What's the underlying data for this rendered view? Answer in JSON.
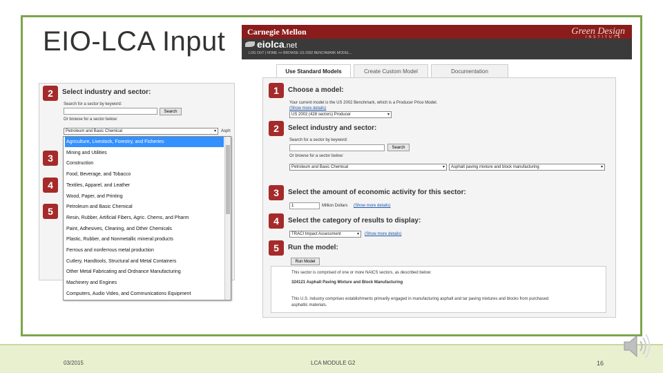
{
  "slide": {
    "title": "EIO-LCA Input",
    "footer_date": "03/2015",
    "footer_module": "LCA MODULE G2",
    "page_number": "16"
  },
  "site": {
    "cmu_logo": "Carnegie Mellon",
    "green_design": "Green Design",
    "green_design_sub": "INSTITUTE",
    "eiolca_name": "eiolca",
    "eiolca_tld": ".net",
    "nav_line": "LOG OUT | HOME >> BROWSE US 2002 BENCHMARK MODEL..."
  },
  "tabs": [
    {
      "label": "Use Standard Models",
      "active": true
    },
    {
      "label": "Create Custom Model",
      "active": false
    },
    {
      "label": "Documentation",
      "active": false
    }
  ],
  "right_panel": {
    "step1": {
      "num": "1",
      "heading": "Choose a model:",
      "current_text": "Your current model is the US 2002 Benchmark, which is a Producer Price Model.",
      "more_details": "(Show more details)",
      "model_select": "US 2002 (428 sectors) Producer"
    },
    "step2": {
      "num": "2",
      "heading": "Select industry and sector:",
      "search_label": "Search for a sector by keyword:",
      "search_button": "Search",
      "browse_label": "Or browse for a sector below:",
      "industry_select": "Petroleum and Basic Chemical",
      "sector_select": "Asphalt paving mixture and block manufacturing"
    },
    "step3": {
      "num": "3",
      "heading": "Select the amount of economic activity for this sector:",
      "amount_value": "1",
      "amount_unit": "Million Dollars",
      "more_details": "(Show more details)"
    },
    "step4": {
      "num": "4",
      "heading": "Select the category of results to display:",
      "category_select": "TRACI Impact Assessment",
      "more_details": "(Show more details)"
    },
    "step5": {
      "num": "5",
      "heading": "Run the model:",
      "run_button": "Run Model"
    },
    "description": {
      "line1": "This sector is comprised of one or more NAICS sectors, as described below:",
      "line2": "324121 Asphalt Paving Mixture and Block Manufacturing",
      "line3": "This U.S. industry comprises establishments primarily engaged in manufacturing asphalt and tar paving mixtures and blocks from purchased",
      "line4": "asphaltic materials."
    }
  },
  "left_panel": {
    "step2": {
      "num": "2",
      "heading": "Select industry and sector:",
      "search_label": "Search for a sector by keyword:",
      "search_button": "Search",
      "browse_label": "Or browse for a sector below:",
      "industry_select": "Petroleum and Basic Chemical",
      "sector_partial": "Asph"
    },
    "step_nums": [
      "3",
      "4",
      "5"
    ],
    "dropdown_items": [
      {
        "label": "Agriculture, Livestock, Forestry, and Fisheries",
        "highlighted": true
      },
      {
        "label": "Mining and Utilities",
        "highlighted": false
      },
      {
        "label": "Construction",
        "highlighted": false
      },
      {
        "label": "Food, Beverage, and Tobacco",
        "highlighted": false
      },
      {
        "label": "Textiles, Apparel, and Leather",
        "highlighted": false
      },
      {
        "label": "Wood, Paper, and Printing",
        "highlighted": false
      },
      {
        "label": "Petroleum and Basic Chemical",
        "highlighted": false
      },
      {
        "label": "Resin, Rubber, Artificial Fibers, Agric. Chems, and Pharm",
        "highlighted": false
      },
      {
        "label": "Paint, Adhesives, Cleaning, and Other Chemicals",
        "highlighted": false
      },
      {
        "label": "Plastic, Rubber, and Nonmetallic mineral products",
        "highlighted": false
      },
      {
        "label": "Ferrous and nonferrous metal production",
        "highlighted": false
      },
      {
        "label": "Cutlery, Handtools, Structural and Metal Containers",
        "highlighted": false
      },
      {
        "label": "Other Metal Fabricating and Ordnance Manufacturing",
        "highlighted": false
      },
      {
        "label": "Machinery and Engines",
        "highlighted": false
      },
      {
        "label": "Computers, Audio Video, and Communications Equipment",
        "highlighted": false
      }
    ]
  }
}
